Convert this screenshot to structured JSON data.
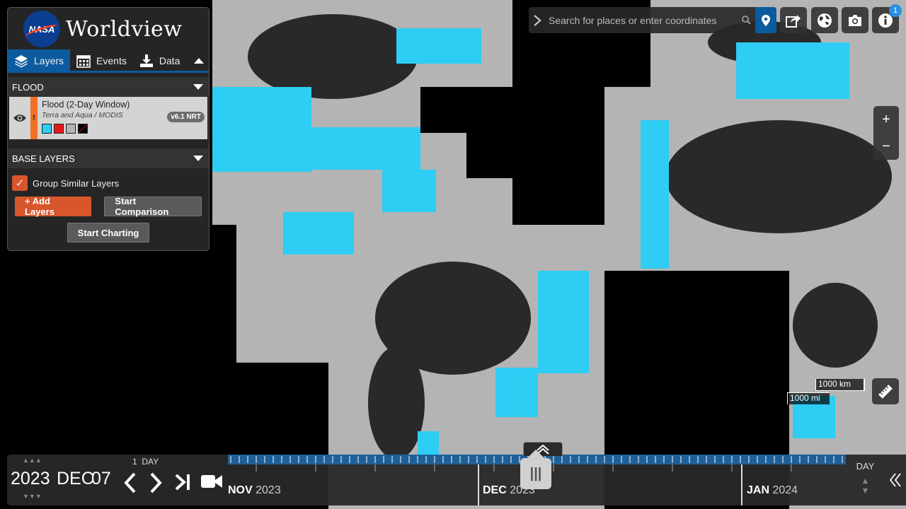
{
  "brand": {
    "nasa": "NASA",
    "app_title": "Worldview"
  },
  "tabs": [
    {
      "label": "Layers",
      "icon": "layers-icon",
      "active": true
    },
    {
      "label": "Events",
      "icon": "calendar-icon",
      "active": false
    },
    {
      "label": "Data",
      "icon": "download-icon",
      "active": false
    }
  ],
  "overlay_group": {
    "title": "FLOOD"
  },
  "layer": {
    "title": "Flood (2-Day Window)",
    "subtitle": "Terra and Aqua / MODIS",
    "badge": "v6.1 NRT",
    "warning": "!",
    "legend_colors": [
      "#2ecdf3",
      "#e61919",
      "#b4b4b4",
      "#000000"
    ]
  },
  "base_group": {
    "title": "BASE LAYERS"
  },
  "group_similar": {
    "label": "Group Similar Layers",
    "checked": true
  },
  "buttons": {
    "add_layers": "+ Add Layers",
    "start_comparison": "Start Comparison",
    "start_charting": "Start Charting"
  },
  "search": {
    "placeholder": "Search for places or enter coordinates"
  },
  "toolbar": {
    "notification_count": "1"
  },
  "zoom": {
    "in": "+",
    "out": "−"
  },
  "scale": {
    "km": "1000 km",
    "mi": "1000 mi"
  },
  "date": {
    "year": "2023",
    "month": "DEC",
    "day": "07",
    "interval_count": "1",
    "interval_unit": "DAY"
  },
  "timeline": {
    "months": [
      {
        "name": "NOV",
        "year": "2023"
      },
      {
        "name": "DEC",
        "year": "2023"
      },
      {
        "name": "JAN",
        "year": "2024"
      }
    ],
    "zoom_level": "DAY"
  },
  "colors": {
    "flood": "#2ecdf3",
    "land": "#b4b4b4",
    "accent": "#d7562b",
    "active_tab": "#0b5b9e"
  }
}
